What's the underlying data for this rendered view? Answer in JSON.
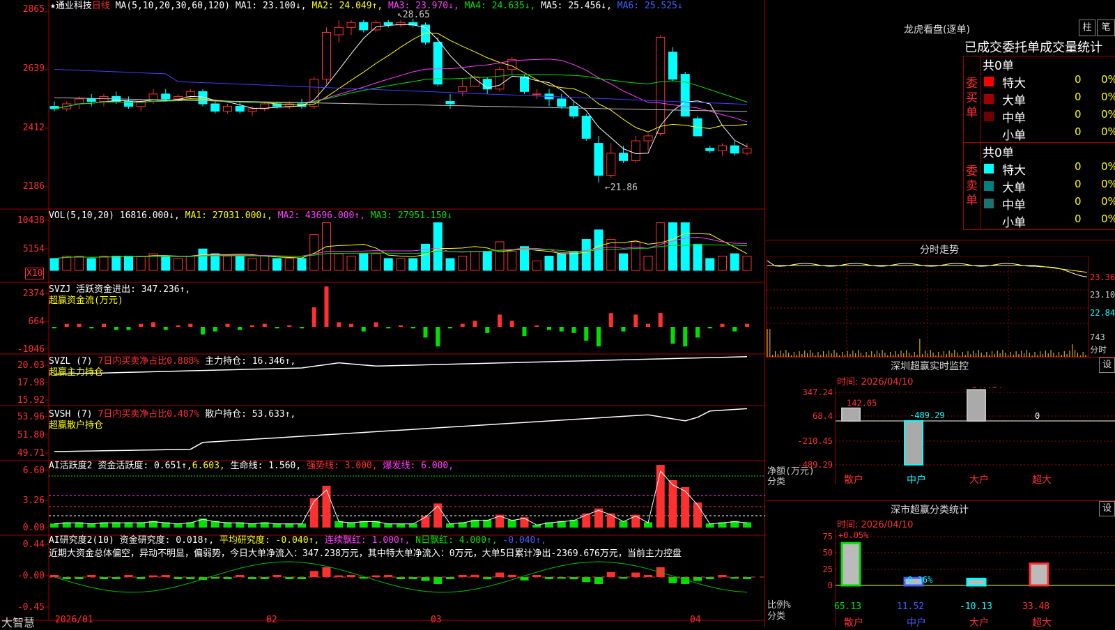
{
  "colors": {
    "up": "#ff3030",
    "down": "#00ffff",
    "grid": "#a00000",
    "ma1": "#ffffff",
    "ma2": "#ffff00",
    "ma3": "#ff40ff",
    "ma4": "#00e000",
    "ma6": "#4040ff"
  },
  "header": {
    "stock": "★通业科技",
    "period": "日线",
    "ma_title": "MA(5,10,20,30,60,120)",
    "ma1": "MA1: 23.100↓,",
    "ma2": "MA2: 24.049↑,",
    "ma3": "MA3: 23.970↓,",
    "ma4": "MA4: 24.635↓,",
    "ma5": "MA5: 25.456↓,",
    "ma6": "MA6: 25.525↓"
  },
  "price_axis": [
    "2865",
    "2639",
    "2412",
    "2186"
  ],
  "price_marks": {
    "high": "28.65",
    "low": "21.86"
  },
  "vol": {
    "title": "VOL(5,10,20)",
    "v": "16816.000↓,",
    "ma1": "MA1: 27031.000↓,",
    "ma2": "MA2: 43696.000↑,",
    "ma3": "MA3: 27951.150↓",
    "axis": [
      "10438",
      "5154"
    ],
    "unit": "X10"
  },
  "svzj": {
    "title": "SVZJ  活跃资金进出: 347.236↑,",
    "sub": "超赢资金流(万元)",
    "axis": [
      "2374",
      "664",
      "-1046"
    ]
  },
  "svzl": {
    "title": "SVZL (7)",
    "ratio": "7日内买卖净占比0.888%",
    "hold": "主力持仓: 16.346↑,",
    "sub": "超赢主力持仓",
    "axis": [
      "20.03",
      "17.98",
      "15.92"
    ]
  },
  "svsh": {
    "title": "SVSH (7)",
    "ratio": "7日内买卖净占比0.487%",
    "hold": "散户持仓: 53.633↑,",
    "sub": "超赢散户持仓",
    "axis": [
      "53.96",
      "51.80",
      "49.71"
    ]
  },
  "ai1": {
    "title": "AI活跃度2",
    "a": "资金活跃度: 0.651↑,",
    "b": "6.603,",
    "c": "生命线: 1.560,",
    "d": "强势线: 3.000,",
    "e": "爆发线: 6.000,",
    "axis": [
      "6.60",
      "3.26",
      "0.00"
    ]
  },
  "ai2": {
    "title": "AI研究度2(10)",
    "a": "资金研究度: 0.018↑,",
    "b": "平均研究度: -0.040↑,",
    "c": "连续飘红: 1.000↑,",
    "d": "N日飘红: 4.000↑,",
    "e": "-0.040↑,",
    "axis": [
      "0.44",
      "-0.00",
      "-0.45"
    ],
    "comment": "近期大资金总体偏空，异动不明显，偏弱势，今日大单净流入：347.238万元，其中特大单净流入：0万元，大单5日累计净出-2369.676万元，当前主力控盘"
  },
  "xaxis": {
    "logo": "大智慧",
    "labels": [
      "2026/01",
      "02",
      "03",
      "04"
    ]
  },
  "right": {
    "dragon_title": "龙虎看盘(逐单)",
    "btn_zhu": "柱",
    "btn_bi": "笔",
    "tabs_label": "已成交委托单成交量统计",
    "buy": {
      "side": "委买单",
      "total": "共0单",
      "rows": [
        {
          "name": "特大",
          "v": "0",
          "p": "0%",
          "c": "#ff0000"
        },
        {
          "name": "大单",
          "v": "0",
          "p": "0%",
          "c": "#a00000"
        },
        {
          "name": "中单",
          "v": "0",
          "p": "0%",
          "c": "#700000"
        },
        {
          "name": "小单",
          "v": "0",
          "p": "0%",
          "c": "#000000"
        }
      ]
    },
    "sell": {
      "side": "委卖单",
      "total": "共0单",
      "rows": [
        {
          "name": "特大",
          "v": "0",
          "p": "0%",
          "c": "#00ffff"
        },
        {
          "name": "大单",
          "v": "0",
          "p": "0%",
          "c": "#008080"
        },
        {
          "name": "中单",
          "v": "0",
          "p": "0%",
          "c": "#207070"
        },
        {
          "name": "小单",
          "v": "0",
          "p": "0%",
          "c": "#000000"
        }
      ]
    },
    "intraday_title": "分时走势",
    "intraday_axis": [
      "23.36",
      "23.10",
      "22.84"
    ],
    "intraday_vol": "743",
    "intraday_unit": "分时",
    "sz_title": "深圳超赢实时监控",
    "sz_btn": "设",
    "sz_time": "时间: 2026/04/10",
    "sz_axis": [
      "347.24",
      "68.4",
      "-210.45",
      "-489.29"
    ],
    "sz_unit1": "净额(万元)",
    "sz_unit2": "分类",
    "sz_cats": [
      "散户",
      "中户",
      "大户",
      "超大"
    ],
    "sz_vals": [
      "142.05",
      "-489.29",
      "347.24",
      "0"
    ],
    "sc_title": "深市超赢分类统计",
    "sc_btn": "设",
    "sc_time": "时间: 2026/04/10",
    "sc_axis": [
      "75",
      "50",
      "25",
      "0"
    ],
    "sc_unit1": "比例%",
    "sc_unit2": "分类",
    "sc_cats": [
      "散户",
      "中户",
      "大户",
      "超大"
    ],
    "sc_vals": [
      "65.13",
      "11.52",
      "-10.13",
      "33.48"
    ],
    "sc_top": [
      "+0.05%",
      "-0.16%"
    ]
  },
  "chart_data": {
    "type": "candlestick",
    "title": "通业科技 日线",
    "y_axis": [
      21.86,
      28.65
    ],
    "x_labels": [
      "2026/01",
      "02",
      "03",
      "04"
    ],
    "ohlc": [
      [
        25.1,
        25.3,
        24.9,
        25.0
      ],
      [
        25.0,
        25.3,
        24.9,
        25.2
      ],
      [
        25.2,
        25.5,
        25.0,
        25.4
      ],
      [
        25.4,
        25.6,
        25.1,
        25.3
      ],
      [
        25.3,
        25.6,
        25.1,
        25.5
      ],
      [
        25.5,
        25.7,
        25.2,
        25.3
      ],
      [
        25.3,
        25.5,
        25.0,
        25.1
      ],
      [
        25.1,
        25.4,
        24.9,
        25.3
      ],
      [
        25.3,
        25.8,
        25.2,
        25.6
      ],
      [
        25.6,
        25.8,
        25.3,
        25.4
      ],
      [
        25.4,
        25.6,
        25.3,
        25.5
      ],
      [
        25.5,
        25.8,
        25.4,
        25.7
      ],
      [
        25.7,
        25.8,
        25.1,
        25.2
      ],
      [
        25.2,
        25.3,
        24.8,
        24.9
      ],
      [
        24.9,
        25.2,
        24.8,
        25.1
      ],
      [
        25.1,
        25.3,
        24.8,
        24.9
      ],
      [
        24.9,
        25.1,
        24.7,
        25.0
      ],
      [
        25.0,
        25.3,
        24.9,
        25.2
      ],
      [
        25.2,
        25.3,
        25.0,
        25.1
      ],
      [
        25.1,
        25.3,
        25.0,
        25.2
      ],
      [
        25.2,
        25.4,
        25.0,
        25.1
      ],
      [
        25.1,
        26.3,
        25.0,
        26.2
      ],
      [
        26.2,
        28.3,
        26.0,
        28.1
      ],
      [
        28.0,
        28.6,
        27.7,
        28.3
      ],
      [
        28.3,
        28.6,
        28.0,
        28.5
      ],
      [
        28.5,
        28.6,
        28.1,
        28.2
      ],
      [
        28.2,
        28.6,
        28.1,
        28.5
      ],
      [
        28.5,
        28.6,
        28.3,
        28.4
      ],
      [
        28.4,
        28.6,
        28.3,
        28.5
      ],
      [
        28.5,
        28.65,
        28.3,
        28.4
      ],
      [
        28.4,
        28.5,
        27.6,
        27.7
      ],
      [
        27.7,
        27.9,
        25.9,
        26.0
      ],
      [
        25.3,
        25.6,
        25.0,
        25.2
      ],
      [
        25.7,
        26.2,
        25.5,
        25.9
      ],
      [
        25.9,
        26.4,
        25.9,
        26.3
      ],
      [
        26.2,
        26.3,
        25.6,
        25.8
      ],
      [
        25.8,
        26.7,
        25.7,
        26.6
      ],
      [
        26.6,
        27.1,
        26.4,
        27.0
      ],
      [
        26.3,
        26.4,
        25.6,
        25.7
      ],
      [
        25.6,
        25.8,
        25.4,
        25.6
      ],
      [
        25.6,
        25.8,
        25.1,
        25.4
      ],
      [
        25.4,
        25.6,
        25.0,
        25.1
      ],
      [
        25.1,
        25.3,
        24.6,
        24.7
      ],
      [
        24.7,
        24.8,
        23.7,
        23.8
      ],
      [
        23.6,
        23.9,
        22.0,
        22.3
      ],
      [
        22.3,
        23.6,
        22.2,
        23.2
      ],
      [
        23.2,
        23.5,
        22.8,
        22.9
      ],
      [
        22.9,
        23.9,
        22.8,
        23.7
      ],
      [
        23.7,
        24.0,
        23.3,
        23.9
      ],
      [
        24.0,
        28.0,
        23.9,
        27.9
      ],
      [
        27.3,
        27.5,
        26.1,
        26.2
      ],
      [
        26.4,
        26.5,
        24.8,
        24.7
      ],
      [
        24.6,
        24.7,
        23.9,
        23.9
      ],
      [
        23.4,
        23.5,
        23.2,
        23.3
      ],
      [
        23.3,
        23.6,
        23.1,
        23.5
      ],
      [
        23.5,
        23.7,
        23.1,
        23.2
      ],
      [
        23.2,
        23.6,
        23.1,
        23.4
      ]
    ],
    "ma_labels": [
      "MA1",
      "MA2",
      "MA3",
      "MA4",
      "MA5",
      "MA6"
    ]
  }
}
